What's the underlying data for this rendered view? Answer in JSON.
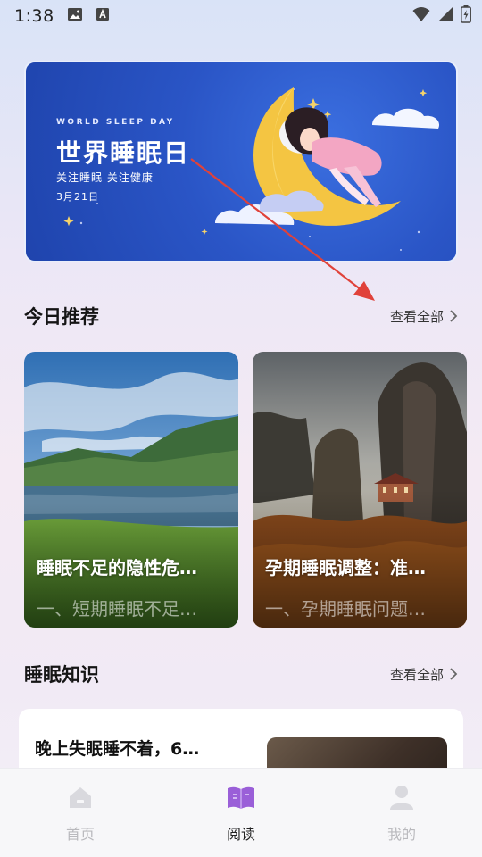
{
  "status_bar": {
    "time": "1:38"
  },
  "banner": {
    "small_caption": "WORLD SLEEP DAY",
    "title": "世界睡眠日",
    "subtitle": "关注睡眠 关注健康",
    "date": "3月21日"
  },
  "today": {
    "title": "今日推荐",
    "see_all": "查看全部",
    "cards": [
      {
        "title": "睡眠不足的隐性危…",
        "desc": "一、短期睡眠不足…"
      },
      {
        "title": "孕期睡眠调整：准…",
        "desc": "一、孕期睡眠问题…"
      }
    ]
  },
  "knowledge": {
    "title": "睡眠知识",
    "see_all": "查看全部",
    "items": [
      {
        "title": "晚上失眠睡不着，6…"
      }
    ]
  },
  "nav": {
    "items": [
      {
        "label": "首页",
        "icon": "home-icon"
      },
      {
        "label": "阅读",
        "icon": "book-icon"
      },
      {
        "label": "我的",
        "icon": "user-icon"
      }
    ],
    "active_color": "#9a5fd8"
  }
}
